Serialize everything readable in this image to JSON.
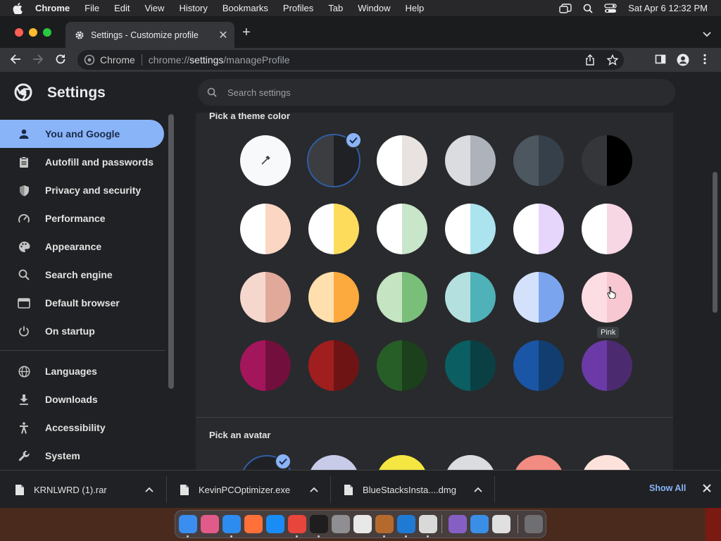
{
  "menubar": {
    "app_name": "Chrome",
    "items": [
      "File",
      "Edit",
      "View",
      "History",
      "Bookmarks",
      "Profiles",
      "Tab",
      "Window",
      "Help"
    ],
    "clock": "Sat Apr 6  12:32 PM"
  },
  "tab": {
    "title": "Settings - Customize profile",
    "close": "✕"
  },
  "newtab": "+",
  "omnibox": {
    "chip": "Chrome",
    "url_scheme": "chrome://",
    "url_host": "settings",
    "url_path": "/manageProfile"
  },
  "settings": {
    "title": "Settings",
    "search_placeholder": "Search settings"
  },
  "sidebar": {
    "items": [
      {
        "label": "You and Google",
        "icon": "person-icon",
        "active": true
      },
      {
        "label": "Autofill and passwords",
        "icon": "clipboard-icon"
      },
      {
        "label": "Privacy and security",
        "icon": "shield-icon"
      },
      {
        "label": "Performance",
        "icon": "speedometer-icon"
      },
      {
        "label": "Appearance",
        "icon": "palette-icon"
      },
      {
        "label": "Search engine",
        "icon": "search-icon"
      },
      {
        "label": "Default browser",
        "icon": "browser-icon"
      },
      {
        "label": "On startup",
        "icon": "power-icon"
      },
      {
        "label": "Languages",
        "icon": "globe-icon"
      },
      {
        "label": "Downloads",
        "icon": "download-icon"
      },
      {
        "label": "Accessibility",
        "icon": "accessibility-icon"
      },
      {
        "label": "System",
        "icon": "wrench-icon"
      }
    ]
  },
  "main": {
    "theme_heading": "Pick a theme color",
    "avatar_heading": "Pick an avatar",
    "hover_tooltip": "Pink",
    "swatches": [
      [
        {
          "l": "#f8f9fa",
          "r": "#f8f9fa",
          "custom": true
        },
        {
          "l": "#3c3d40",
          "r": "#202124",
          "selected": true
        },
        {
          "l": "#ffffff",
          "r": "#e8e3e1"
        },
        {
          "l": "#dadce0",
          "r": "#aeb2ba"
        },
        {
          "l": "#4d5760",
          "r": "#36404a"
        },
        {
          "l": "#35363a",
          "r": "#000000"
        }
      ],
      [
        {
          "l": "#ffffff",
          "r": "#fbd6c3"
        },
        {
          "l": "#ffffff",
          "r": "#fddc5c"
        },
        {
          "l": "#ffffff",
          "r": "#c8e6c9"
        },
        {
          "l": "#ffffff",
          "r": "#abe3ee"
        },
        {
          "l": "#ffffff",
          "r": "#e6d6fb"
        },
        {
          "l": "#ffffff",
          "r": "#f8d7e4"
        }
      ],
      [
        {
          "l": "#f6d7cd",
          "r": "#e0a99a"
        },
        {
          "l": "#ffdfae",
          "r": "#fca93e"
        },
        {
          "l": "#c5e5c2",
          "r": "#79be79"
        },
        {
          "l": "#b5e0e0",
          "r": "#4fb2b8"
        },
        {
          "l": "#d4e1fa",
          "r": "#7aa5ee"
        },
        {
          "l": "#fcdde3",
          "r": "#f8c8d2"
        }
      ],
      [
        {
          "l": "#a4165c",
          "r": "#720f3d"
        },
        {
          "l": "#a11e1e",
          "r": "#6f1414"
        },
        {
          "l": "#275e27",
          "r": "#1c3f1c"
        },
        {
          "l": "#0b5e61",
          "r": "#0a4043"
        },
        {
          "l": "#1a56a5",
          "r": "#123d70"
        },
        {
          "l": "#6b3aa6",
          "r": "#4c2a70"
        }
      ]
    ]
  },
  "downloads": {
    "items": [
      "KRNLWRD (1).rar",
      "KevinPCOptimizer.exe",
      "BlueStacksInsta....dmg"
    ],
    "show_all": "Show All",
    "close": "✕"
  },
  "dock": {
    "apps": [
      {
        "name": "finder-icon",
        "color": "#3b8df0"
      },
      {
        "name": "launchpad-icon",
        "color": "#e05a8a"
      },
      {
        "name": "safari-icon",
        "color": "#2d8cf0"
      },
      {
        "name": "firefox-icon",
        "color": "#ff7139"
      },
      {
        "name": "app-store-icon",
        "color": "#1a8cf5"
      },
      {
        "name": "chrome-icon",
        "color": "#e8453c"
      },
      {
        "name": "terminal-icon",
        "color": "#1e1e1e"
      },
      {
        "name": "system-settings-icon",
        "color": "#8e8e93"
      },
      {
        "name": "script-editor-icon",
        "color": "#e8e8e8"
      },
      {
        "name": "instruments-icon",
        "color": "#b56a2d"
      },
      {
        "name": "vscode-icon",
        "color": "#1f7ad4"
      },
      {
        "name": "roblox-studio-icon",
        "color": "#d9d9d9"
      },
      {
        "name": "visual-studio-icon",
        "color": "#865fc5"
      },
      {
        "name": "onedrive-icon",
        "color": "#3a8ee6"
      },
      {
        "name": "roblox-icon",
        "color": "#e0e0e0"
      },
      {
        "name": "trash-icon",
        "color": "#6e6e73"
      }
    ]
  }
}
